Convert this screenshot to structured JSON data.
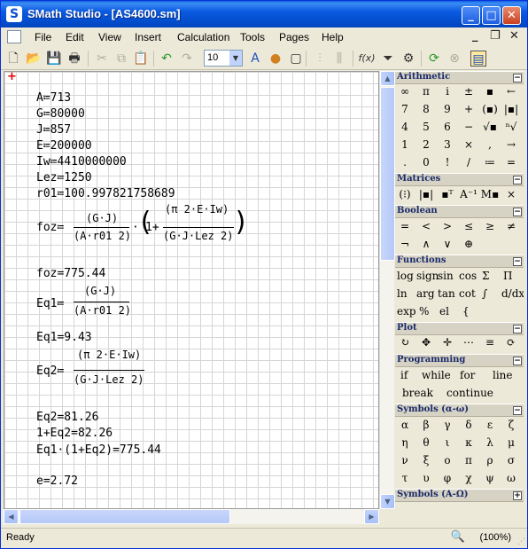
{
  "window": {
    "title": "SMath Studio - [AS4600.sm]",
    "app_icon": "S",
    "minimize": "_",
    "maximize": "□",
    "close": "✕"
  },
  "menu": {
    "items": [
      "File",
      "Edit",
      "View",
      "Insert",
      "Calculation",
      "Tools",
      "Pages",
      "Help"
    ],
    "doc_min": "_",
    "doc_restore": "❐",
    "doc_close": "✕"
  },
  "toolbar": {
    "font_size": "10",
    "function_label": "f(x)"
  },
  "worksheet": {
    "cursor": "+",
    "A": "A≔713",
    "G": "G≔80000",
    "J": "J≔857",
    "E": "E≔200000",
    "Iw": "Iw≔4410000000",
    "Lez": "Lez≔1250",
    "r01": "r01≔100.997821758689",
    "foz_lhs": "foz≔",
    "foz_num1": "(G·J)",
    "foz_den1": "(A·r01 2)",
    "foz_mid": "·",
    "foz_one": "1+",
    "foz_num2": "(π 2·E·Iw)",
    "foz_den2": "(G·J·Lez 2)",
    "foz_result": "foz=775.44",
    "eq1_lhs": "Eq1≔",
    "eq1_num": "(G·J)",
    "eq1_den": "(A·r01 2)",
    "eq1_result": "Eq1=9.43",
    "eq2_lhs": "Eq2≔",
    "eq2_num": "(π 2·E·Iw)",
    "eq2_den": "(G·J·Lez 2)",
    "eq2_result": "Eq2=81.26",
    "sum": "1+Eq2=82.26",
    "prod": "Eq1·(1+Eq2)=775.44",
    "e": "e=2.72"
  },
  "panels": {
    "arithmetic": {
      "title": "Arithmetic",
      "rows": [
        [
          "∞",
          "π",
          "i",
          "±",
          "▪",
          "←"
        ],
        [
          "7",
          "8",
          "9",
          "+",
          "(▪)",
          "|▪|"
        ],
        [
          "4",
          "5",
          "6",
          "−",
          "√▪",
          "ⁿ√"
        ],
        [
          "1",
          "2",
          "3",
          "×",
          ",",
          "→"
        ],
        [
          ".",
          "0",
          "!",
          "/",
          "≔",
          "="
        ]
      ]
    },
    "matrices": {
      "title": "Matrices",
      "items": [
        "(⁝)",
        "|▪|",
        "▪ᵀ",
        "A⁻¹",
        "M▪",
        "×"
      ]
    },
    "boolean": {
      "title": "Boolean",
      "rows": [
        [
          "=",
          "<",
          ">",
          "≤",
          "≥",
          "≠"
        ],
        [
          "¬",
          "∧",
          "∨",
          "⊕"
        ]
      ]
    },
    "functions": {
      "title": "Functions",
      "rows": [
        [
          "log",
          "sign",
          "sin",
          "cos",
          "Σ",
          "Π"
        ],
        [
          "ln",
          "arg",
          "tan",
          "cot",
          "∫",
          "d/dx"
        ],
        [
          "exp",
          "%",
          "el",
          "{"
        ]
      ]
    },
    "plot": {
      "title": "Plot",
      "items": [
        "↻",
        "✥",
        "✛",
        "⋯",
        "≡",
        "⟳"
      ]
    },
    "programming": {
      "title": "Programming",
      "row1": [
        "if",
        "while",
        "for",
        "line"
      ],
      "row2": [
        "break",
        "continue"
      ]
    },
    "symbols_lower": {
      "title": "Symbols (α-ω)",
      "rows": [
        [
          "α",
          "β",
          "γ",
          "δ",
          "ε",
          "ζ"
        ],
        [
          "η",
          "θ",
          "ι",
          "κ",
          "λ",
          "μ"
        ],
        [
          "ν",
          "ξ",
          "ο",
          "π",
          "ρ",
          "σ"
        ],
        [
          "τ",
          "υ",
          "φ",
          "χ",
          "ψ",
          "ω"
        ]
      ]
    },
    "symbols_upper": {
      "title": "Symbols (Α-Ω)"
    }
  },
  "status": {
    "text": "Ready",
    "zoom": "(100%)"
  },
  "colors": {
    "title_blue": "#0a5ae0",
    "cursor_red": "#e00000",
    "panel_header": "#1a2b6a"
  }
}
